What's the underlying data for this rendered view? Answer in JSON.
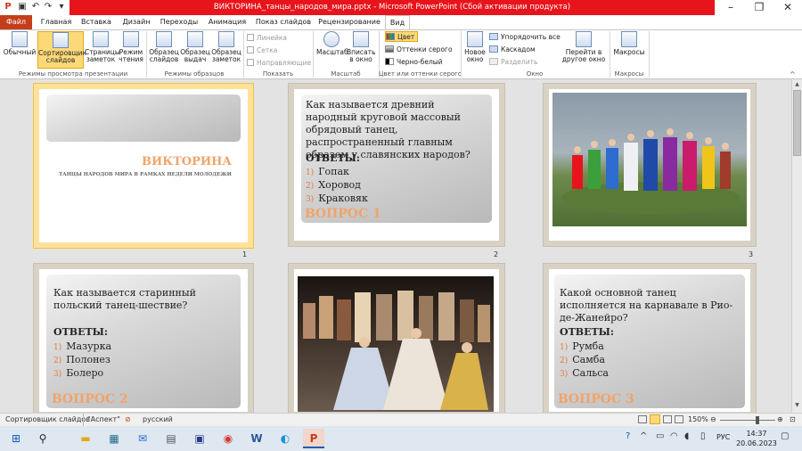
{
  "window": {
    "title": "ВИКТОРИНА_танцы_народов_мира.pptx  -  Microsoft PowerPoint (Сбой активации продукта)"
  },
  "tabs": [
    "Файл",
    "Главная",
    "Вставка",
    "Дизайн",
    "Переходы",
    "Анимация",
    "Показ слайдов",
    "Рецензирование",
    "Вид"
  ],
  "ribbon": {
    "views": [
      "Обычный",
      "Сортировщик слайдов",
      "Страницы заметок",
      "Режим чтения"
    ],
    "views_group": "Режимы просмотра презентации",
    "masters": [
      "Образец слайдов",
      "Образец выдач",
      "Образец заметок"
    ],
    "masters_group": "Режимы образцов",
    "show": [
      "Линейка",
      "Сетка",
      "Направляющие"
    ],
    "show_group": "Показать",
    "zoom": [
      "Масштаб",
      "Вписать в окно"
    ],
    "zoom_group": "Масштаб",
    "color": [
      "Цвет",
      "Оттенки серого",
      "Черно-белый"
    ],
    "color_group": "Цвет или оттенки серого",
    "window": [
      "Новое окно",
      "Упорядочить все",
      "Каскадом",
      "Разделить",
      "Перейти в другое окно"
    ],
    "window_group": "Окно",
    "macros": [
      "Макросы"
    ],
    "macros_group": "Макросы"
  },
  "slides": [
    {
      "num": "1",
      "title": "ВИКТОРИНА",
      "subtitle": "ТАНЦЫ НАРОДОВ МИРА В РАМКАХ НЕДЕЛИ МОЛОДЕЖИ"
    },
    {
      "num": "2",
      "question": "Как называется древний народный круговой массовый обрядовый танец, распространенный главным образом у славянских народов?",
      "answers_label": "ОТВЕТЫ:",
      "answers": [
        "Гопак",
        "Хоровод",
        "Краковяк"
      ],
      "label": "ВОПРОС 1"
    },
    {
      "num": "3"
    },
    {
      "question": "Как называется старинный польский танец-шествие?",
      "answers_label": "ОТВЕТЫ:",
      "answers": [
        "Мазурка",
        "Полонез",
        "Болеро"
      ],
      "label": "ВОПРОС 2"
    },
    {},
    {
      "question": "Какой основной танец исполняется на карнавале в Рио-де-Жанейро?",
      "answers_label": "ОТВЕТЫ:",
      "answers": [
        "Румба",
        "Самба",
        "Сальса"
      ],
      "label": "ВОПРОС 3"
    }
  ],
  "status": {
    "mode": "Сортировщик слайдов",
    "theme": "\"Аспект\"",
    "lang": "русский",
    "zoom": "150%"
  },
  "taskbar": {
    "lang": "РУС",
    "time": "14:37",
    "date": "20.06.2023"
  }
}
